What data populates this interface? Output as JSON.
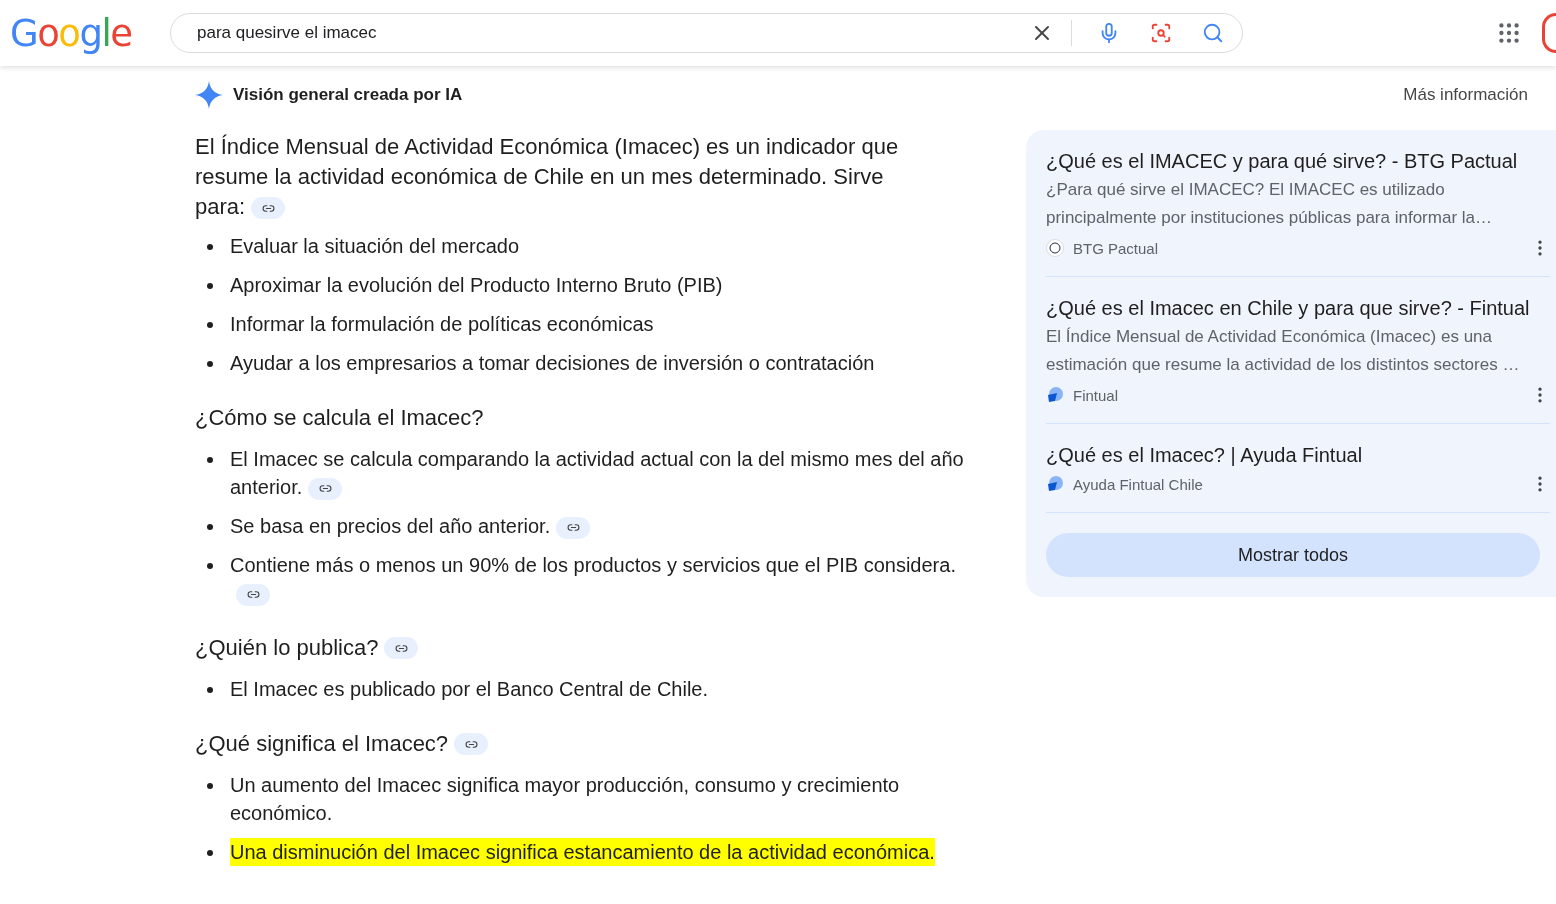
{
  "header": {
    "logo": "Google",
    "search": {
      "value": "para quesirve el imacec"
    }
  },
  "overview": {
    "title": "Visión general creada por IA",
    "more_link": "Más información",
    "intro": {
      "text": "El Índice Mensual de Actividad Económica (Imacec) es un indicador que resume la actividad económica de Chile en un mes determinado. Sirve para:",
      "has_link": true
    },
    "sections": [
      {
        "bullets": [
          {
            "text": "Evaluar la situación del mercado",
            "has_link": false,
            "highlighted": false
          },
          {
            "text": "Aproximar la evolución del Producto Interno Bruto (PIB)",
            "has_link": false,
            "highlighted": false
          },
          {
            "text": "Informar la formulación de políticas económicas",
            "has_link": false,
            "highlighted": false
          },
          {
            "text": "Ayudar a los empresarios a tomar decisiones de inversión o contratación",
            "has_link": false,
            "highlighted": false
          }
        ]
      },
      {
        "heading": "¿Cómo se calcula el Imacec?",
        "heading_link": false,
        "bullets": [
          {
            "text": "El Imacec se calcula comparando la actividad actual con la del mismo mes del año anterior.",
            "has_link": true,
            "highlighted": false
          },
          {
            "text": "Se basa en precios del año anterior.",
            "has_link": true,
            "highlighted": false
          },
          {
            "text": "Contiene más o menos un 90% de los productos y servicios que el PIB considera.",
            "has_link": true,
            "highlighted": false
          }
        ]
      },
      {
        "heading": "¿Quién lo publica?",
        "heading_link": true,
        "bullets": [
          {
            "text": "El Imacec es publicado por el Banco Central de Chile.",
            "has_link": false,
            "highlighted": false
          }
        ]
      },
      {
        "heading": "¿Qué significa el Imacec?",
        "heading_link": true,
        "bullets": [
          {
            "text": "Un aumento del Imacec significa mayor producción, consumo y crecimiento económico.",
            "has_link": false,
            "highlighted": false
          },
          {
            "text": "Una disminución del Imacec significa estancamiento de la actividad económica.",
            "has_link": false,
            "highlighted": true
          }
        ]
      }
    ]
  },
  "sources": {
    "items": [
      {
        "title": "¿Qué es el IMACEC y para qué sirve? - BTG Pactual",
        "snippet": "¿Para qué sirve el IMACEC? El IMACEC es utilizado principalmente por instituciones públicas para informar la…",
        "site": "BTG Pactual",
        "kind": "btg"
      },
      {
        "title": "¿Qué es el Imacec en Chile y para que sirve? - Fintual",
        "snippet": "El Índice Mensual de Actividad Económica (Imacec) es una estimación que resume la actividad de los distintos sectores …",
        "site": "Fintual",
        "kind": "fintual"
      },
      {
        "title": "¿Qué es el Imacec? | Ayuda Fintual",
        "site": "Ayuda Fintual Chile",
        "kind": "fintual"
      }
    ],
    "show_all": "Mostrar todos"
  }
}
